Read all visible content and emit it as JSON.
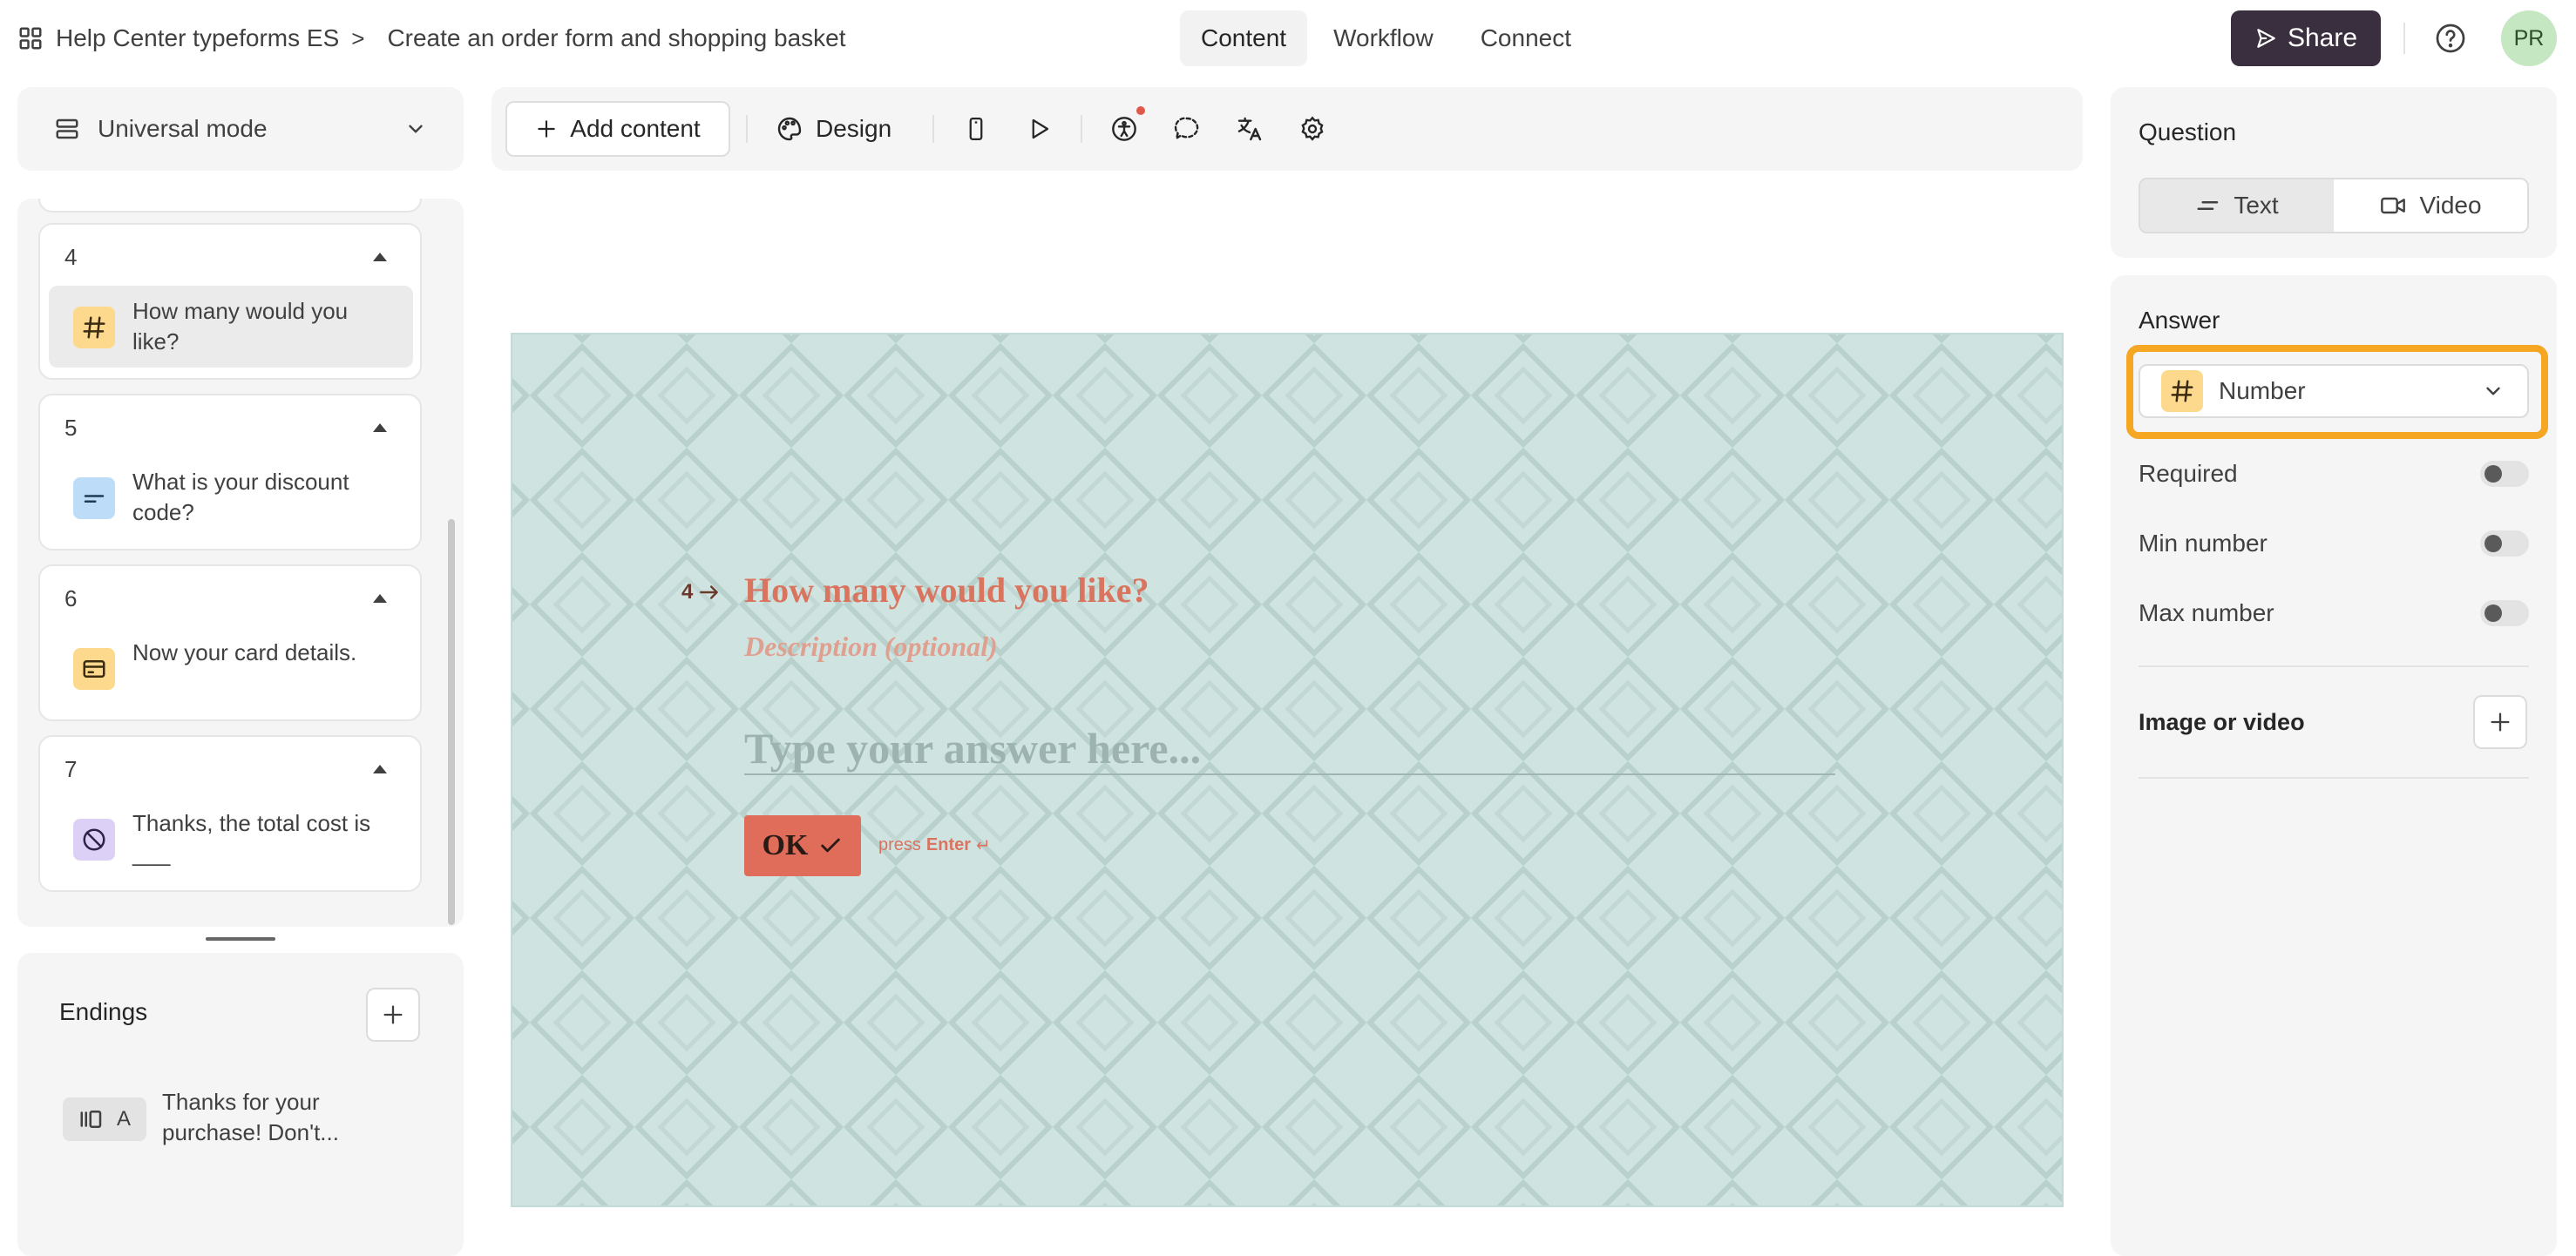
{
  "topbar": {
    "workspace": "Help Center typeforms ES",
    "separator": ">",
    "form_title": "Create an order form and shopping basket",
    "tabs": [
      "Content",
      "Workflow",
      "Connect"
    ],
    "active_tab": "Content",
    "share_label": "Share",
    "avatar_initials": "PR"
  },
  "left_panel": {
    "mode_label": "Universal mode",
    "questions": [
      {
        "number": "4",
        "text": "How many would you like?",
        "icon": "hash-icon",
        "icon_color": "#fcd98c",
        "selected": true
      },
      {
        "number": "5",
        "text": "What is your discount code?",
        "icon": "short-text-icon",
        "icon_color": "#bcdcf7",
        "selected": false
      },
      {
        "number": "6",
        "text": "Now your card details.",
        "icon": "card-icon",
        "icon_color": "#fcd98c",
        "selected": false
      },
      {
        "number": "7",
        "text": "Thanks, the total cost is ___",
        "icon": "statement-icon",
        "icon_color": "#ddd0f7",
        "selected": false
      }
    ],
    "endings": {
      "title": "Endings",
      "items": [
        {
          "badge": "A",
          "text": "Thanks for your purchase! Don't..."
        }
      ]
    }
  },
  "toolbar": {
    "add_content_label": "Add content",
    "design_label": "Design"
  },
  "preview": {
    "question_number": "4",
    "question_text": "How many would you like?",
    "description_placeholder": "Description (optional)",
    "answer_placeholder": "Type your answer here...",
    "ok_label": "OK",
    "hint_prefix": "press",
    "hint_key": "Enter",
    "hint_symbol": "↵",
    "colors": {
      "background": "#cfe4e1",
      "question": "#d9755f",
      "button": "#e06d59"
    }
  },
  "right_panel": {
    "question_section_title": "Question",
    "question_types": [
      "Text",
      "Video"
    ],
    "active_question_type": "Text",
    "answer_section_title": "Answer",
    "answer_type": "Number",
    "settings": [
      {
        "label": "Required",
        "enabled": false
      },
      {
        "label": "Min number",
        "enabled": false
      },
      {
        "label": "Max number",
        "enabled": false
      }
    ],
    "media_label": "Image or video",
    "highlight_color": "#f5a623"
  }
}
